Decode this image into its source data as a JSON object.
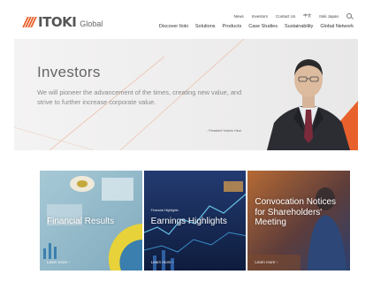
{
  "header": {
    "logo": {
      "brand": "ITOKI",
      "suffix": "Global"
    },
    "util_nav": {
      "news": "News",
      "investors": "Investors",
      "contact": "Contact Us",
      "language": "中文",
      "region": "Itoki Japan"
    },
    "main_nav": [
      "Discover Itoki",
      "Solutions",
      "Products",
      "Case Studies",
      "Sustainability",
      "Global Network"
    ]
  },
  "hero": {
    "title": "Investors",
    "text": "We will pioneer the advancement of the times, creating new value, and strive to further increase corporate value.",
    "caption": "- President Yoshiro Hirai"
  },
  "cards": [
    {
      "title": "Financial Results",
      "link": "Learn more"
    },
    {
      "eyebrow": "Financial Highlights",
      "title": "Earnings Highlights",
      "link": "Learn more"
    },
    {
      "title": "Convocation Notices for Shareholders' Meeting",
      "link": "Learn more"
    }
  ],
  "colors": {
    "accent": "#e8612c",
    "text": "#555555",
    "hero_bg": "#efeeee"
  },
  "icons": {
    "search": "search-icon",
    "logo": "itoki-logo-mark"
  }
}
